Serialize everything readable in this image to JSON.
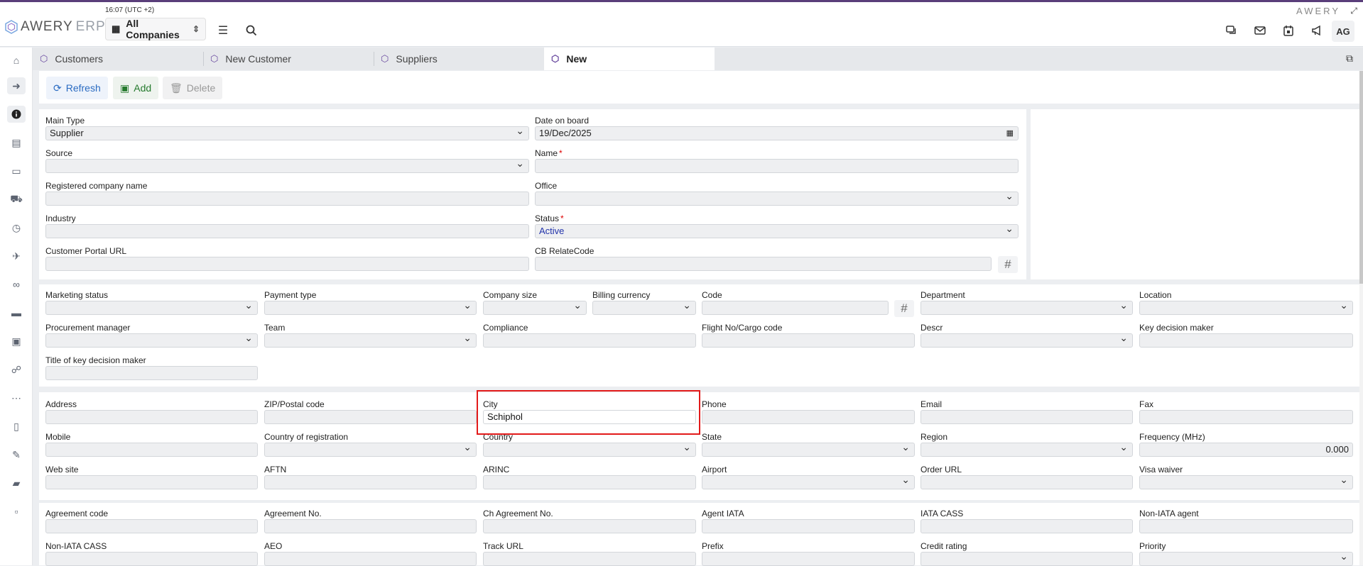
{
  "header": {
    "logo_text": "AWERY",
    "logo_suffix": "ERP",
    "clock": "16:07 (UTC +2)",
    "company_selector": "All Companies",
    "brand_right": "AWERY",
    "avatar_initials": "AG"
  },
  "tabs": [
    {
      "label": "Customers"
    },
    {
      "label": "New Customer"
    },
    {
      "label": "Suppliers"
    },
    {
      "label": "New"
    }
  ],
  "toolbar": {
    "refresh_label": "Refresh",
    "add_label": "Add",
    "delete_label": "Delete"
  },
  "section1": {
    "main_type": {
      "label": "Main Type",
      "value": "Supplier"
    },
    "date_on_board": {
      "label": "Date on board",
      "value": "19/Dec/2025"
    },
    "source": {
      "label": "Source",
      "value": ""
    },
    "name": {
      "label": "Name",
      "value": ""
    },
    "registered_company_name": {
      "label": "Registered company name",
      "value": ""
    },
    "office": {
      "label": "Office",
      "value": ""
    },
    "industry": {
      "label": "Industry",
      "value": ""
    },
    "status": {
      "label": "Status",
      "value": "Active"
    },
    "customer_portal_url": {
      "label": "Customer Portal URL",
      "value": ""
    },
    "cb_relatecode": {
      "label": "CB RelateCode",
      "value": ""
    }
  },
  "section2": {
    "marketing_status": {
      "label": "Marketing status",
      "value": ""
    },
    "payment_type": {
      "label": "Payment type",
      "value": ""
    },
    "company_size": {
      "label": "Company size",
      "value": ""
    },
    "billing_currency": {
      "label": "Billing currency",
      "value": ""
    },
    "code": {
      "label": "Code",
      "value": ""
    },
    "department": {
      "label": "Department",
      "value": ""
    },
    "location": {
      "label": "Location",
      "value": ""
    },
    "procurement_manager": {
      "label": "Procurement manager",
      "value": ""
    },
    "team": {
      "label": "Team",
      "value": ""
    },
    "compliance": {
      "label": "Compliance",
      "value": ""
    },
    "flight_no": {
      "label": "Flight No/Cargo code",
      "value": ""
    },
    "descr": {
      "label": "Descr",
      "value": ""
    },
    "key_decision_maker": {
      "label": "Key decision maker",
      "value": ""
    },
    "title_key_decision_maker": {
      "label": "Title of key decision maker",
      "value": ""
    }
  },
  "section3": {
    "address": {
      "label": "Address",
      "value": ""
    },
    "zip": {
      "label": "ZIP/Postal code",
      "value": ""
    },
    "city": {
      "label": "City",
      "value": "Schiphol"
    },
    "phone": {
      "label": "Phone",
      "value": ""
    },
    "email": {
      "label": "Email",
      "value": ""
    },
    "fax": {
      "label": "Fax",
      "value": ""
    },
    "mobile": {
      "label": "Mobile",
      "value": ""
    },
    "country_registration": {
      "label": "Country of registration",
      "value": ""
    },
    "country": {
      "label": "Country",
      "value": ""
    },
    "state": {
      "label": "State",
      "value": ""
    },
    "region": {
      "label": "Region",
      "value": ""
    },
    "frequency": {
      "label": "Frequency (MHz)",
      "value": "0.000"
    },
    "web_site": {
      "label": "Web site",
      "value": ""
    },
    "aftn": {
      "label": "AFTN",
      "value": ""
    },
    "arinc": {
      "label": "ARINC",
      "value": ""
    },
    "airport": {
      "label": "Airport",
      "value": ""
    },
    "order_url": {
      "label": "Order URL",
      "value": ""
    },
    "visa_waiver": {
      "label": "Visa waiver",
      "value": ""
    }
  },
  "section4": {
    "agreement_code": {
      "label": "Agreement code",
      "value": ""
    },
    "agreement_no": {
      "label": "Agreement No.",
      "value": ""
    },
    "ch_agreement_no": {
      "label": "Ch Agreement No.",
      "value": ""
    },
    "agent_iata": {
      "label": "Agent IATA",
      "value": ""
    },
    "iata_cass": {
      "label": "IATA CASS",
      "value": ""
    },
    "non_iata_agent": {
      "label": "Non-IATA agent",
      "value": ""
    },
    "non_iata_cass": {
      "label": "Non-IATA CASS",
      "value": ""
    },
    "aeo": {
      "label": "AEO",
      "value": ""
    },
    "track_url": {
      "label": "Track URL",
      "value": ""
    },
    "prefix": {
      "label": "Prefix",
      "value": ""
    },
    "credit_rating": {
      "label": "Credit rating",
      "value": ""
    },
    "priority": {
      "label": "Priority",
      "value": ""
    }
  }
}
